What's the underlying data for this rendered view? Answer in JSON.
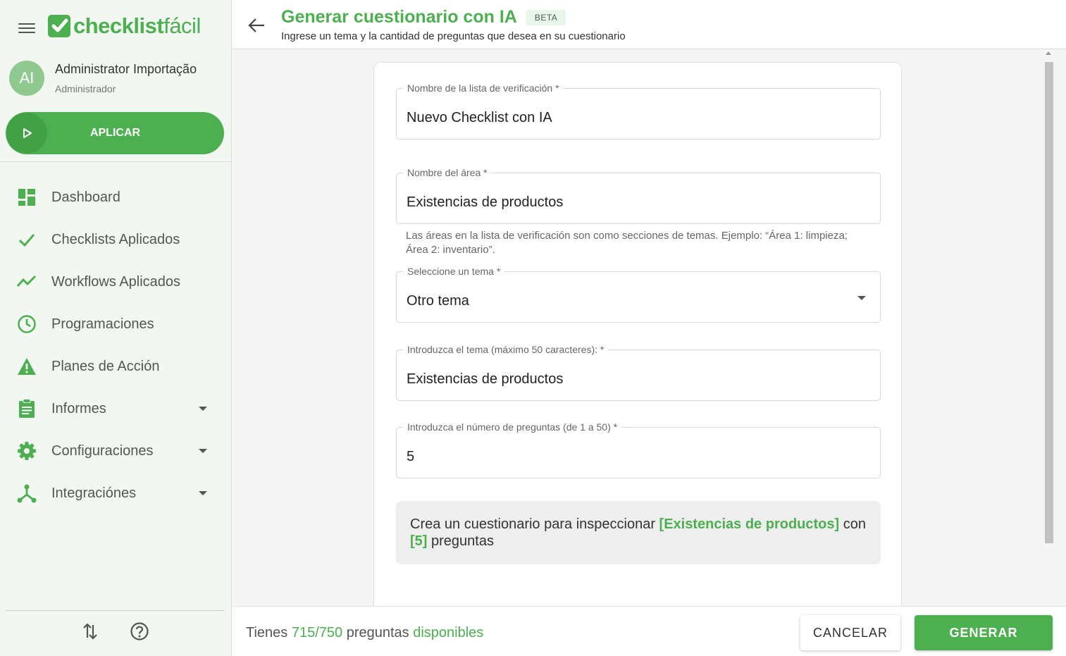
{
  "brand": {
    "logo_bold": "checklist",
    "logo_light": "fácil",
    "accent": "#4caf50"
  },
  "user": {
    "initials": "AI",
    "name": "Administrator Importação",
    "role": "Administrador"
  },
  "apply_button": {
    "label": "APLICAR",
    "icon": "play-icon"
  },
  "nav": [
    {
      "label": "Dashboard",
      "icon": "dashboard-icon",
      "has_submenu": false
    },
    {
      "label": "Checklists Aplicados",
      "icon": "check-icon",
      "has_submenu": false
    },
    {
      "label": "Workflows Aplicados",
      "icon": "trend-icon",
      "has_submenu": false
    },
    {
      "label": "Programaciones",
      "icon": "clock-icon",
      "has_submenu": false
    },
    {
      "label": "Planes de Acción",
      "icon": "warning-icon",
      "has_submenu": false
    },
    {
      "label": "Informes",
      "icon": "clipboard-icon",
      "has_submenu": true
    },
    {
      "label": "Configuraciones",
      "icon": "gear-icon",
      "has_submenu": true
    },
    {
      "label": "Integraciónes",
      "icon": "hub-icon",
      "has_submenu": true
    }
  ],
  "header": {
    "title": "Generar cuestionario con IA",
    "badge": "BETA",
    "subtitle": "Ingrese un tema y la cantidad de preguntas que desea en su cuestionario"
  },
  "form": {
    "checklist_name": {
      "label": "Nombre de la lista de verificación *",
      "value": "Nuevo Checklist con IA"
    },
    "area_name": {
      "label": "Nombre del área *",
      "value": "Existencias de productos"
    },
    "area_helper": "Las áreas en la lista de verificación son como secciones de temas. Ejemplo: “Área 1: limpieza; Área 2: inventario”.",
    "topic_select": {
      "label": "Seleccione un tema *",
      "value": "Otro tema"
    },
    "topic_input": {
      "label": "Introduzca el tema (máximo 50 caracteres): *",
      "value": "Existencias de productos"
    },
    "question_count": {
      "label": "Introduzca el número de preguntas (de 1 a 50) *",
      "value": "5"
    }
  },
  "summary": {
    "prefix": "Crea un cuestionario para inspeccionar ",
    "topic": "[Existencias de productos]",
    "middle": " con ",
    "count": "[5]",
    "suffix": " preguntas"
  },
  "footer": {
    "avail_prefix": "Tienes ",
    "avail_count": "715/750",
    "avail_middle": " preguntas ",
    "avail_suffix": "disponibles",
    "cancel_label": "CANCELAR",
    "generate_label": "GENERAR"
  }
}
